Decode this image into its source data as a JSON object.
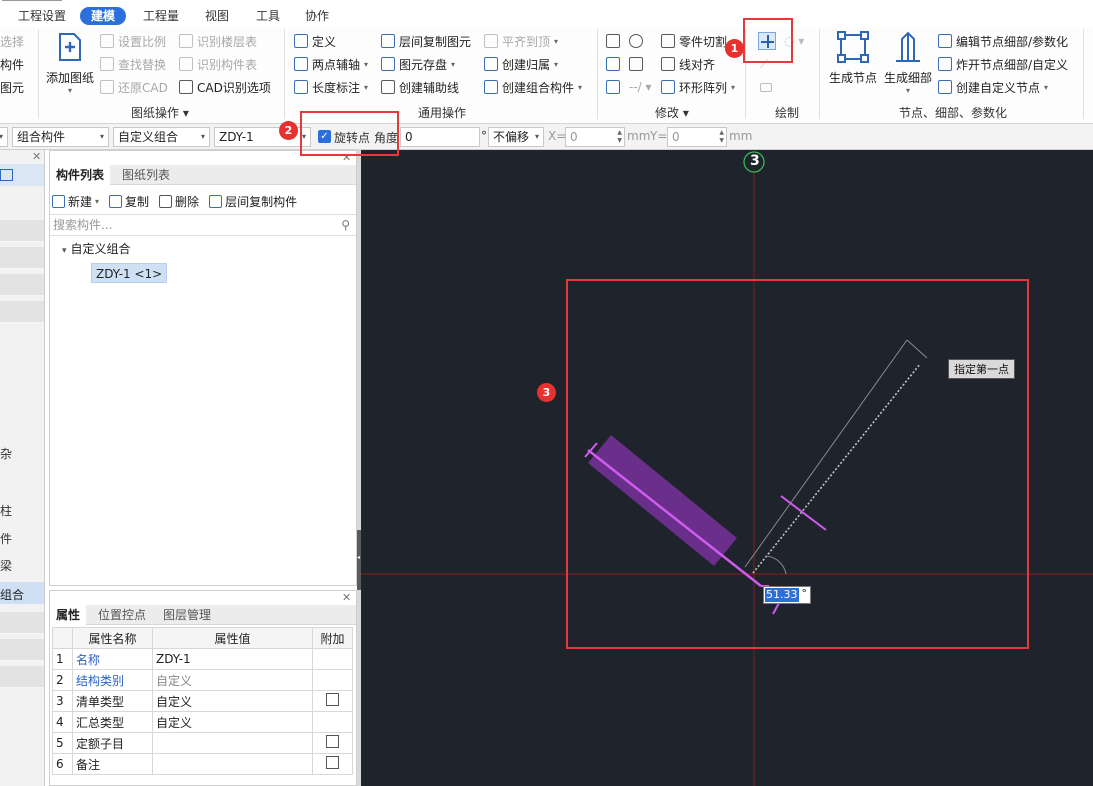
{
  "menu": {
    "tabs": [
      "工程设置",
      "建模",
      "工程量",
      "视图",
      "工具",
      "协作"
    ],
    "active": "建模"
  },
  "ribbon": {
    "drawing_ops": {
      "title": "图纸操作",
      "add_drawing": "添加图纸",
      "set_scale": "设置比例",
      "find_replace": "查找替换",
      "restore_cad": "还原CAD",
      "identify_floors": "识别楼层表",
      "identify_components": "识别构件表",
      "cad_options": "CAD识别选项",
      "left_clip": [
        "选择",
        "构件",
        "图元"
      ]
    },
    "general_ops": {
      "title": "通用操作",
      "define": "定义",
      "two_point_axis": "两点辅轴",
      "length_dim": "长度标注",
      "copy_floor": "层间复制图元",
      "save_element": "图元存盘",
      "create_aux_line": "创建辅助线",
      "align_top": "平齐到顶",
      "create_belong": "创建归属",
      "create_group": "创建组合构件"
    },
    "modify": {
      "title": "修改",
      "part_cut": "零件切割",
      "line_align": "线对齐",
      "ring_array": "环形阵列"
    },
    "draw": {
      "title": "绘制"
    },
    "nodes": {
      "title": "节点、细部、参数化",
      "gen_node": "生成节点",
      "gen_detail": "生成细部",
      "edit_node": "编辑节点细部/参数化",
      "explode_node": "炸开节点细部/自定义",
      "create_custom": "创建自定义节点"
    }
  },
  "optionbar": {
    "combo1": "组合构件",
    "combo2": "自定义组合",
    "combo3": "ZDY-1",
    "rotate_label": "旋转点",
    "angle_label": "角度",
    "angle_value": "0",
    "degree": "°",
    "offset": "不偏移",
    "x_label": "X=",
    "x_value": "0",
    "mm1": "mm",
    "y_label": "Y=",
    "y_value": "0",
    "mm2": "mm"
  },
  "leftstrip": {
    "texts": [
      "杂",
      "柱",
      "件",
      "梁",
      "组合"
    ]
  },
  "components": {
    "tabs": [
      "构件列表",
      "图纸列表"
    ],
    "toolbar": {
      "new": "新建",
      "copy": "复制",
      "delete": "删除",
      "floor_copy": "层间复制构件"
    },
    "search_placeholder": "搜索构件...",
    "tree_group": "自定义组合",
    "tree_item": "ZDY-1 <1>"
  },
  "properties": {
    "tabs": [
      "属性",
      "位置控点",
      "图层管理"
    ],
    "headers": [
      "属性名称",
      "属性值",
      "附加"
    ],
    "rows": [
      {
        "no": "1",
        "name": "名称",
        "value": "ZDY-1"
      },
      {
        "no": "2",
        "name": "结构类别",
        "value": "自定义"
      },
      {
        "no": "3",
        "name": "清单类型",
        "value": "自定义"
      },
      {
        "no": "4",
        "name": "汇总类型",
        "value": "自定义"
      },
      {
        "no": "5",
        "name": "定额子目",
        "value": ""
      },
      {
        "no": "6",
        "name": "备注",
        "value": ""
      }
    ]
  },
  "canvas": {
    "axis_label": "3",
    "tooltip": "指定第一点",
    "angle_input": "51.33",
    "degree": "°"
  },
  "annotations": [
    "1",
    "2",
    "3"
  ],
  "colors": {
    "accent": "#2b6fdc",
    "canvas_bg": "#1f232b",
    "member": "#6a2f8a",
    "highlight": "#e33b3b"
  }
}
